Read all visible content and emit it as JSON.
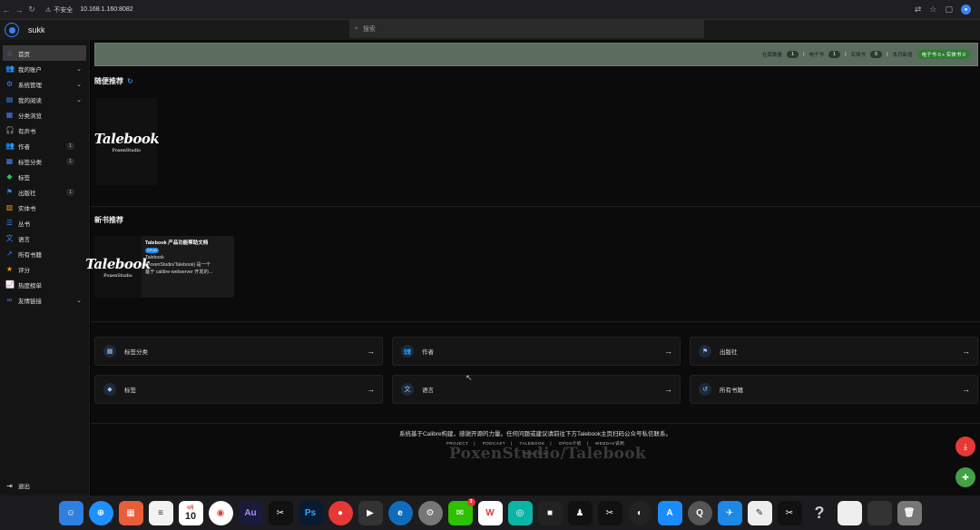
{
  "browser": {
    "insecure_label": "不安全",
    "url": "10.168.1.160:8082"
  },
  "app": {
    "username": "sukk",
    "search_placeholder": "搜索"
  },
  "sidebar": {
    "items": [
      {
        "label": "首页",
        "icon": "home-icon",
        "active": true
      },
      {
        "label": "我的账户",
        "icon": "people-icon",
        "chevron": true
      },
      {
        "label": "系统管理",
        "icon": "gear-icon",
        "chevron": true
      },
      {
        "label": "我的阅读",
        "icon": "book-icon",
        "chevron": true
      },
      {
        "label": "分类浏览",
        "icon": "grid-icon"
      },
      {
        "label": "有声书",
        "icon": "headphones-icon"
      },
      {
        "label": "作者",
        "icon": "people-icon",
        "count": "1"
      },
      {
        "label": "标签分类",
        "icon": "grid-icon",
        "count": "1"
      },
      {
        "label": "标签",
        "icon": "tag-icon"
      },
      {
        "label": "出版社",
        "icon": "publisher-icon",
        "count": "1"
      },
      {
        "label": "实体书",
        "icon": "library-icon"
      },
      {
        "label": "丛书",
        "icon": "series-icon"
      },
      {
        "label": "语言",
        "icon": "translate-icon"
      },
      {
        "label": "所有书籍",
        "icon": "trend-icon"
      },
      {
        "label": "评分",
        "icon": "star-icon"
      },
      {
        "label": "热度榜单",
        "icon": "chart-icon"
      },
      {
        "label": "友情链接",
        "icon": "link-icon",
        "chevron": true
      }
    ],
    "logout_label": "退出"
  },
  "stats": {
    "in_library_label": "在库数量",
    "in_library_value": "1",
    "ebook_label": "电子书",
    "ebook_value": "1",
    "physical_label": "实体书",
    "physical_value": "0",
    "month_new_label": "本月新增",
    "month_new_value": "电子书 0 + 实体书 0"
  },
  "random": {
    "title": "随便推荐"
  },
  "cover": {
    "title": "Talebook",
    "subtitle": "PoxenStudio"
  },
  "new_books": {
    "title": "新书推荐",
    "items": [
      {
        "title": "Talebook 产品功能帮助文档",
        "badge": "EPUB",
        "desc1": "Talebook",
        "desc2": "(PoxenStudio/Talebook) 是一个",
        "desc3": "基于 calibre-webserver 开发的..."
      }
    ]
  },
  "nav_cards": [
    {
      "label": "标签分类",
      "icon": "grid-icon"
    },
    {
      "label": "作者",
      "icon": "people-icon"
    },
    {
      "label": "出版社",
      "icon": "publisher-icon"
    },
    {
      "label": "标签",
      "icon": "tag-icon"
    },
    {
      "label": "语言",
      "icon": "translate-icon"
    },
    {
      "label": "所有书籍",
      "icon": "history-icon"
    }
  ],
  "footer": {
    "text": "系统基于Calibre构建，感谢开源的力量。任何问题或建议请前往下方Talebook主页扫码公众号私信联系。",
    "links": [
      "PROJECT",
      "PODCAST",
      "TALEBOOK",
      "OPDS介绍",
      "WEBDAV说明"
    ],
    "version": "Version: v3.x.x",
    "watermark": "PoxenStudio/Talebook"
  },
  "colors": {
    "accent": "#3b82f6",
    "stats_bar": "#5b6d5e",
    "fab_upload": "#e53935",
    "fab_import": "#43a047"
  },
  "dock": {
    "calendar_month": "4月",
    "calendar_day": "10",
    "wechat_badge": "3"
  }
}
